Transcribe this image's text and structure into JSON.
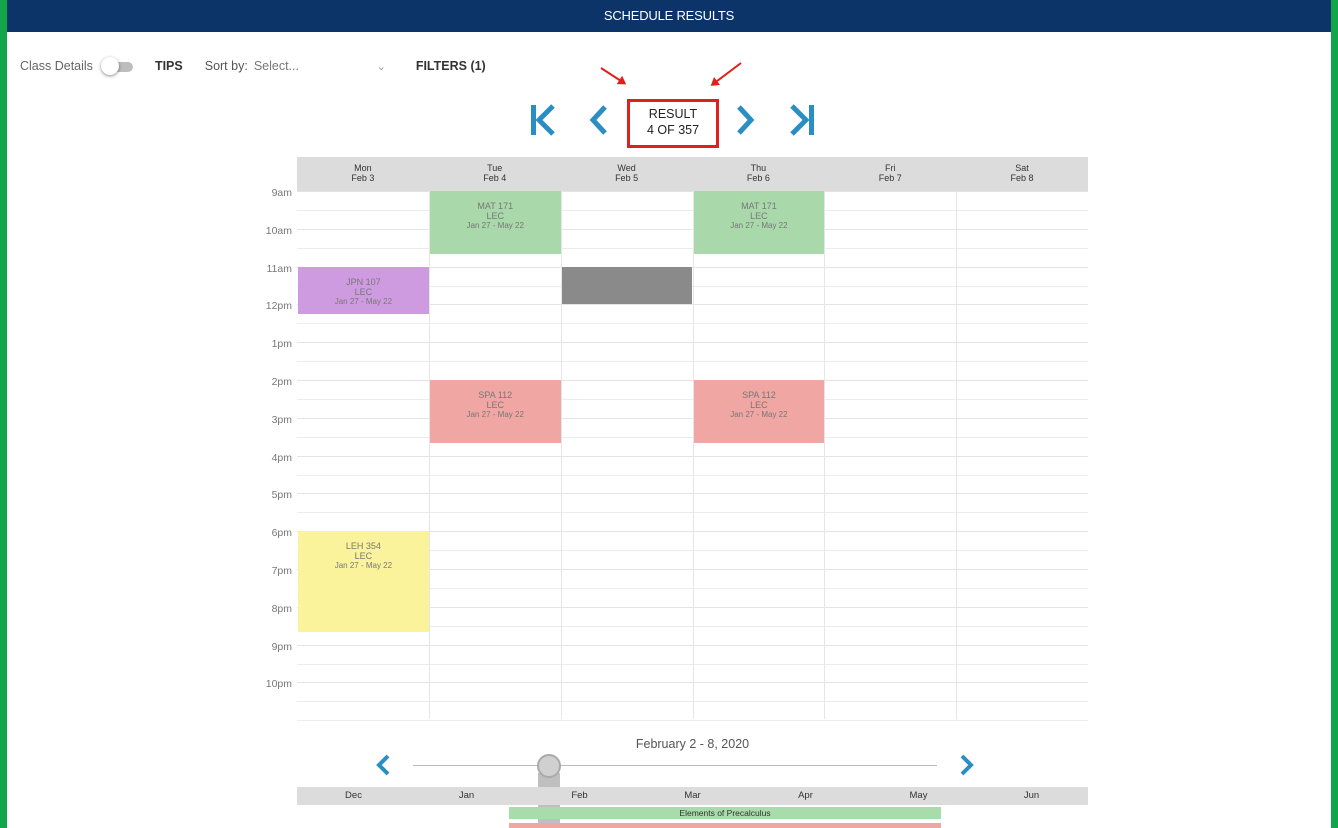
{
  "window": {
    "title": "SCHEDULE RESULTS"
  },
  "toolbar": {
    "class_details_label": "Class Details",
    "class_details_on": false,
    "tips_label": "TIPS",
    "sort_label": "Sort by:",
    "sort_value": "Select...",
    "filters_label": "FILTERS (1)"
  },
  "result_nav": {
    "result_label": "RESULT",
    "result_count": "4 OF 357"
  },
  "days": [
    {
      "day": "Mon",
      "date": "Feb 3"
    },
    {
      "day": "Tue",
      "date": "Feb 4"
    },
    {
      "day": "Wed",
      "date": "Feb 5"
    },
    {
      "day": "Thu",
      "date": "Feb 6"
    },
    {
      "day": "Fri",
      "date": "Feb 7"
    },
    {
      "day": "Sat",
      "date": "Feb 8"
    }
  ],
  "times": [
    "9am",
    "10am",
    "11am",
    "12pm",
    "1pm",
    "2pm",
    "3pm",
    "4pm",
    "5pm",
    "6pm",
    "7pm",
    "8pm",
    "9pm",
    "10pm"
  ],
  "events": [
    {
      "course": "MAT 171",
      "type": "LEC",
      "dates": "Jan 27 - May 22",
      "day": "Tue",
      "start": "9:00",
      "end": "10:40",
      "color": "#a9d8aa"
    },
    {
      "course": "MAT 171",
      "type": "LEC",
      "dates": "Jan 27 - May 22",
      "day": "Thu",
      "start": "9:00",
      "end": "10:40",
      "color": "#a9d8aa"
    },
    {
      "course": "JPN 107",
      "type": "LEC",
      "dates": "Jan 27 - May 22",
      "day": "Mon",
      "start": "11:00",
      "end": "12:15",
      "color": "#cf9be0"
    },
    {
      "course": "",
      "type": "",
      "dates": "",
      "day": "Wed",
      "start": "11:00",
      "end": "12:00",
      "color": "#8a8a8a"
    },
    {
      "course": "SPA 112",
      "type": "LEC",
      "dates": "Jan 27 - May 22",
      "day": "Tue",
      "start": "14:00",
      "end": "15:40",
      "color": "#f0a6a3"
    },
    {
      "course": "SPA 112",
      "type": "LEC",
      "dates": "Jan 27 - May 22",
      "day": "Thu",
      "start": "14:00",
      "end": "15:40",
      "color": "#f0a6a3"
    },
    {
      "course": "LEH 354",
      "type": "LEC",
      "dates": "Jan 27 - May 22",
      "day": "Mon",
      "start": "18:00",
      "end": "20:40",
      "color": "#fbf29c"
    }
  ],
  "timeline": {
    "range": "February 2 - 8, 2020",
    "months": [
      "Dec",
      "Jan",
      "Feb",
      "Mar",
      "Apr",
      "May",
      "Jun"
    ],
    "bars": [
      {
        "label": "Elements of Precalculus",
        "color": "#a8dcaa"
      },
      {
        "label": "",
        "color": "#f0a7a3"
      }
    ]
  },
  "colors": {
    "title_bar": "#0d3468",
    "frame": "#12a64a",
    "annotation": "#e0201b",
    "nav_accent": "#2b8ec3"
  }
}
